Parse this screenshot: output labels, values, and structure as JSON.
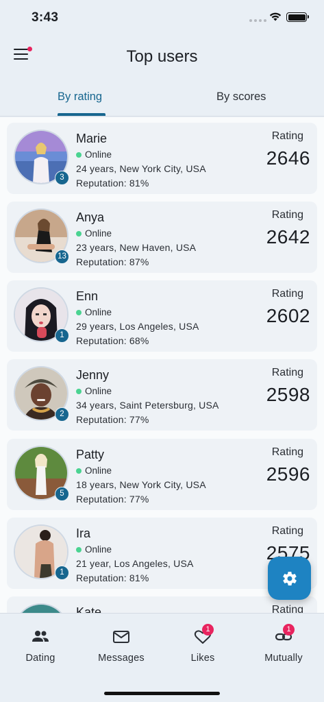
{
  "status_bar": {
    "time": "3:43"
  },
  "header": {
    "title": "Top users",
    "menu_icon": "hamburger-icon",
    "menu_has_notification": true
  },
  "tabs": [
    {
      "label": "By rating",
      "active": true
    },
    {
      "label": "By scores",
      "active": false
    }
  ],
  "users": [
    {
      "name": "Marie",
      "status": "Online",
      "info": "24 years, New York City, USA",
      "reputation": "Reputation: 81%",
      "rating_label": "Rating",
      "rating": "2646",
      "rank": "3"
    },
    {
      "name": "Anya",
      "status": "Online",
      "info": "23 years, New Haven, USA",
      "reputation": "Reputation: 87%",
      "rating_label": "Rating",
      "rating": "2642",
      "rank": "13"
    },
    {
      "name": "Enn",
      "status": "Online",
      "info": "29 years, Los Angeles, USA",
      "reputation": "Reputation: 68%",
      "rating_label": "Rating",
      "rating": "2602",
      "rank": "1"
    },
    {
      "name": "Jenny",
      "status": "Online",
      "info": "34 years, Saint Petersburg, USA",
      "reputation": "Reputation: 77%",
      "rating_label": "Rating",
      "rating": "2598",
      "rank": "2"
    },
    {
      "name": "Patty",
      "status": "Online",
      "info": "18 years, New York City, USA",
      "reputation": "Reputation: 77%",
      "rating_label": "Rating",
      "rating": "2596",
      "rank": "5"
    },
    {
      "name": "Ira",
      "status": "Online",
      "info": "21 year, Los Angeles, USA",
      "reputation": "Reputation: 81%",
      "rating_label": "Rating",
      "rating": "2575",
      "rank": "1"
    },
    {
      "name": "Kate",
      "status": "",
      "info": "",
      "reputation": "",
      "rating_label": "Rating",
      "rating": "",
      "rank": ""
    }
  ],
  "fab": {
    "icon": "gear-icon"
  },
  "bottom_nav": [
    {
      "label": "Dating",
      "icon": "people-icon",
      "badge": ""
    },
    {
      "label": "Messages",
      "icon": "envelope-icon",
      "badge": ""
    },
    {
      "label": "Likes",
      "icon": "heart-icon",
      "badge": "1"
    },
    {
      "label": "Mutually",
      "icon": "link-icon",
      "badge": "1"
    }
  ],
  "colors": {
    "accent": "#17668f",
    "fab": "#1e83c2",
    "badge": "#e8245f",
    "online": "#4ad391"
  }
}
